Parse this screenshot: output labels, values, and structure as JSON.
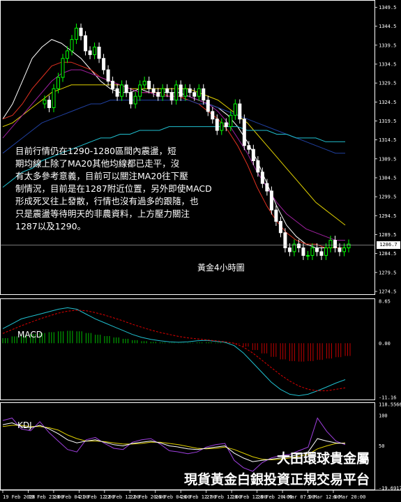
{
  "annotation": {
    "lines": [
      "目前行情仍在1290-1280區間內震盪，短",
      "期均線上除了MA20其他均線都已走平，沒",
      "有太多參考意義，目前可以關注MA20往下壓",
      "制情況，目前是在1287附近位置，另外即使MACD",
      "形成死叉往上發散，行情也沒有過多的跟隨，也",
      "只是震盪等待明天的非農資料，上方壓力關注",
      "1287以及1290。"
    ]
  },
  "chart_subtitle": "黃金4小時圖",
  "macd_label": "MACD",
  "kdj_label": "KDJ",
  "brand": {
    "line1": "大田環球貴金屬",
    "line2": "現貨黃金白銀投資正規交易平台"
  },
  "current_price_label": "1286.7",
  "colors": {
    "background": "#000000",
    "bull_candle": "#00ff00",
    "bear_candle": "#ffffff",
    "ma_white": "#ffffff",
    "ma_red": "#e03020",
    "ma_yellow": "#e0d000",
    "ma_cyan": "#20c0d0",
    "ma_navy": "#2040a0",
    "ma_purple": "#a020a0",
    "macd_pos": "#00c000",
    "macd_neg": "#c00000",
    "macd_signal": "#e00000",
    "kdj_k": "#ffffff",
    "kdj_d": "#e0d000",
    "kdj_j": "#a040e0"
  },
  "chart_data": [
    {
      "type": "candlestick",
      "title": "黃金4小時圖",
      "price_ticks": [
        "1349.5",
        "1344.5",
        "1339.5",
        "1334.5",
        "1329.5",
        "1324.5",
        "1319.5",
        "1314.5",
        "1309.5",
        "1304.5",
        "1299.5",
        "1294.5",
        "1289.5",
        "1284.5",
        "1279.5",
        "1274.5"
      ],
      "ylim": [
        1274.5,
        1350.5
      ],
      "time_labels": [
        "19 Feb 2018",
        "19 Feb 23:00",
        "20 Feb 04:00",
        "21 Feb 12:00",
        "22 Feb 12:00",
        "22 Feb 20:00",
        "26 Feb 04:00",
        "26 Feb 12:00",
        "27 Feb 12:00",
        "28 Feb 12:00",
        "28 Feb 20:00",
        "4 Mar 07:00",
        "5 Mar 12:00",
        "6 Mar 20:00"
      ],
      "close": [
        1325,
        1323,
        1328,
        1331,
        1336,
        1338,
        1341,
        1344,
        1342,
        1338,
        1337,
        1339,
        1336,
        1333,
        1330,
        1328,
        1326,
        1329,
        1327,
        1324,
        1326,
        1329,
        1330,
        1328,
        1327,
        1326,
        1328,
        1327,
        1325,
        1329,
        1326,
        1328,
        1327,
        1326,
        1328,
        1325,
        1322,
        1320,
        1317,
        1319,
        1318,
        1321,
        1324,
        1320,
        1313,
        1312,
        1309,
        1306,
        1303,
        1301,
        1296,
        1293,
        1290,
        1286,
        1285,
        1287,
        1286,
        1284,
        1284,
        1286,
        1285,
        1284,
        1286,
        1288,
        1286,
        1285,
        1286,
        1287
      ],
      "current_price": 1286.7,
      "moving_averages": [
        {
          "color": "ma_white",
          "values": [
            1320,
            1324,
            1330,
            1336,
            1339,
            1341,
            1340,
            1338,
            1336,
            1333,
            1330,
            1328,
            1327,
            1327,
            1328,
            1327,
            1327,
            1327,
            1327,
            1326,
            1325,
            1324,
            1323,
            1321,
            1318,
            1314,
            1309,
            1303,
            1297,
            1292,
            1289,
            1287,
            1286,
            1286,
            1286,
            1286
          ]
        },
        {
          "color": "ma_red",
          "values": [
            1320,
            1321,
            1324,
            1328,
            1331,
            1334,
            1335,
            1335,
            1334,
            1333,
            1331,
            1330,
            1329,
            1328,
            1327,
            1327,
            1327,
            1326,
            1326,
            1325,
            1324,
            1322,
            1320,
            1317,
            1313,
            1308,
            1302,
            1297,
            1293,
            1290,
            1288,
            1287,
            1287,
            1286,
            1286,
            1286
          ]
        },
        {
          "color": "ma_yellow",
          "values": [
            1318,
            1319,
            1321,
            1323,
            1325,
            1327,
            1328,
            1329,
            1329,
            1329,
            1329,
            1329,
            1329,
            1328,
            1328,
            1328,
            1328,
            1328,
            1328,
            1328,
            1327,
            1326,
            1325,
            1323,
            1321,
            1319,
            1316,
            1313,
            1310,
            1307,
            1304,
            1301,
            1298,
            1296,
            1294,
            1292
          ]
        },
        {
          "color": "ma_navy",
          "values": [
            1311,
            1313,
            1315,
            1317,
            1319,
            1320,
            1321,
            1322,
            1323,
            1324,
            1324,
            1325,
            1325,
            1325,
            1325,
            1325,
            1325,
            1325,
            1325,
            1325,
            1324,
            1324,
            1323,
            1322,
            1321,
            1320,
            1319,
            1318,
            1317,
            1316,
            1315,
            1314,
            1313,
            1312,
            1311,
            1311
          ]
        },
        {
          "color": "ma_cyan",
          "values": [
            1302,
            1304,
            1306,
            1307,
            1309,
            1310,
            1311,
            1312,
            1313,
            1314,
            1315,
            1315,
            1316,
            1316,
            1317,
            1317,
            1317,
            1318,
            1318,
            1318,
            1318,
            1318,
            1318,
            1318,
            1318,
            1317,
            1317,
            1317,
            1316,
            1316,
            1315,
            1315,
            1315,
            1314,
            1314,
            1314
          ]
        },
        {
          "color": "ma_purple",
          "values": [
            1315,
            1318,
            1321,
            1324,
            1327,
            1330,
            1332,
            1333,
            1333,
            1332,
            1331,
            1330,
            1329,
            1328,
            1327,
            1327,
            1326,
            1326,
            1326,
            1326,
            1325,
            1324,
            1322,
            1319,
            1315,
            1311,
            1306,
            1302,
            1298,
            1295,
            1293,
            1291,
            1290,
            1289,
            1288,
            1288
          ]
        }
      ]
    },
    {
      "type": "macd",
      "label": "MACD",
      "ticks": [
        "8.65",
        "0.00",
        "-11.16"
      ],
      "ylim": [
        -11.16,
        8.65
      ],
      "macd": [
        3.0,
        4.0,
        5.0,
        5.5,
        6.0,
        6.5,
        7.0,
        7.3,
        7.0,
        6.0,
        5.0,
        4.2,
        3.4,
        2.6,
        1.8,
        1.2,
        0.8,
        0.5,
        0.3,
        0.2,
        0.3,
        0.5,
        0.6,
        0.4,
        0.2,
        -0.5,
        -2.0,
        -4.0,
        -6.0,
        -8.0,
        -9.5,
        -10.5,
        -10.8,
        -10.5,
        -9.8,
        -9.0,
        -8.2,
        -7.5
      ],
      "signal": [
        2.0,
        2.8,
        3.6,
        4.3,
        5.0,
        5.6,
        6.2,
        6.6,
        6.8,
        6.7,
        6.3,
        5.8,
        5.2,
        4.6,
        3.9,
        3.3,
        2.7,
        2.2,
        1.8,
        1.4,
        1.1,
        0.9,
        0.7,
        0.5,
        0.3,
        0.0,
        -0.8,
        -2.0,
        -3.5,
        -5.0,
        -6.5,
        -7.8,
        -8.8,
        -9.5,
        -9.8,
        -9.8,
        -9.5,
        -9.2
      ]
    },
    {
      "type": "kdj",
      "label": "KDJ",
      "ticks": [
        "118.5566",
        "100",
        "50",
        "-19.6917"
      ],
      "ylim": [
        -19.6917,
        118.5566
      ],
      "k": [
        85,
        88,
        82,
        80,
        84,
        78,
        70,
        60,
        55,
        58,
        60,
        56,
        52,
        50,
        54,
        56,
        58,
        55,
        50,
        48,
        45,
        44,
        46,
        48,
        50,
        38,
        30,
        24,
        26,
        28,
        30,
        32,
        36,
        40,
        62,
        58,
        55,
        54
      ],
      "d": [
        82,
        84,
        84,
        82,
        82,
        80,
        76,
        68,
        62,
        58,
        58,
        57,
        55,
        53,
        53,
        54,
        56,
        56,
        54,
        52,
        49,
        46,
        45,
        46,
        48,
        44,
        38,
        32,
        28,
        27,
        28,
        30,
        33,
        36,
        45,
        50,
        54,
        55
      ],
      "j": [
        92,
        96,
        78,
        75,
        90,
        72,
        58,
        44,
        40,
        60,
        64,
        54,
        46,
        44,
        56,
        60,
        62,
        53,
        42,
        40,
        37,
        40,
        48,
        52,
        54,
        26,
        14,
        8,
        22,
        30,
        34,
        36,
        42,
        48,
        96,
        74,
        58,
        52
      ]
    }
  ]
}
